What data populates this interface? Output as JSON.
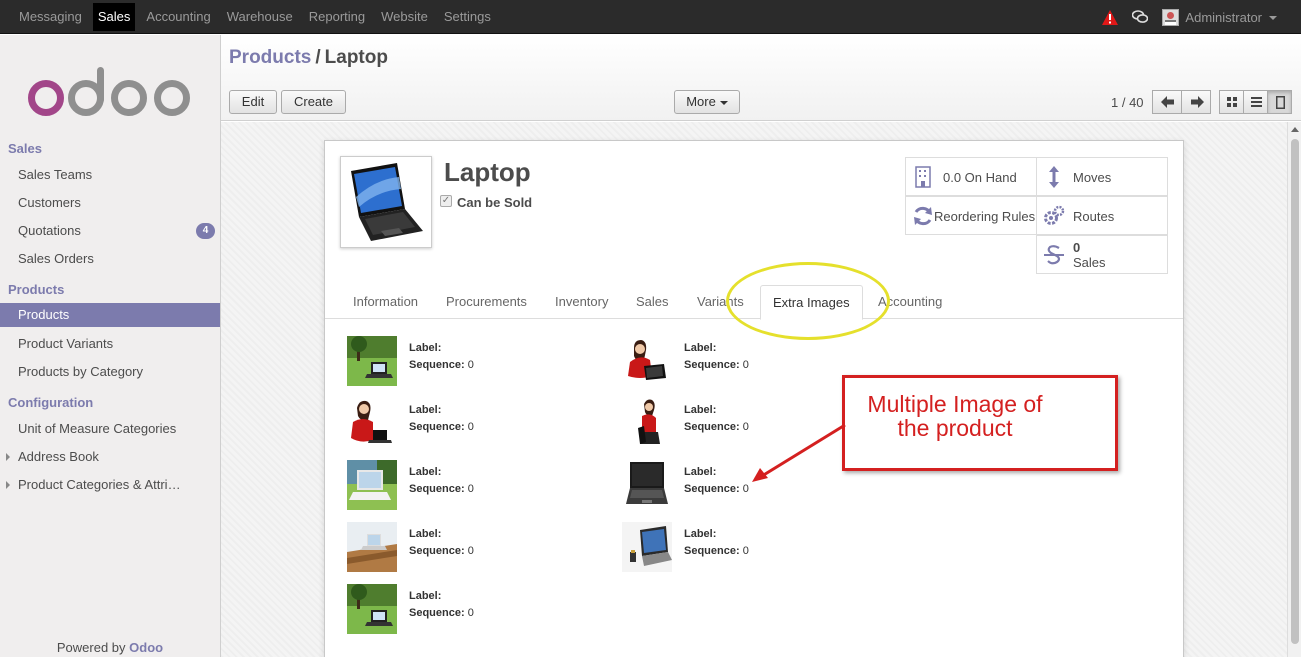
{
  "topbar": {
    "menu": [
      "Messaging",
      "Sales",
      "Accounting",
      "Warehouse",
      "Reporting",
      "Website",
      "Settings"
    ],
    "active": "Sales",
    "user": "Administrator"
  },
  "sidebar": {
    "sections": {
      "sales": "Sales",
      "products": "Products",
      "configuration": "Configuration"
    },
    "items": {
      "sales_teams": "Sales Teams",
      "customers": "Customers",
      "quotations": "Quotations",
      "quotations_badge": "4",
      "sales_orders": "Sales Orders",
      "products": "Products",
      "product_variants": "Product Variants",
      "products_by_category": "Products by Category",
      "uom_categories": "Unit of Measure Categories",
      "address_book": "Address Book",
      "product_categories": "Product Categories & Attri…"
    },
    "powered_prefix": "Powered by ",
    "powered_brand": "Odoo"
  },
  "control_panel": {
    "breadcrumb_parent": "Products",
    "breadcrumb_sep": "/",
    "breadcrumb_current": "Laptop",
    "edit_label": "Edit",
    "create_label": "Create",
    "more_label": "More",
    "pager": "1 / 40"
  },
  "product": {
    "name": "Laptop",
    "can_be_sold_label": "Can be Sold",
    "can_be_sold": true
  },
  "smart_buttons": {
    "on_hand": "0.0 On Hand",
    "moves": "Moves",
    "reordering": "Reordering Rules",
    "routes": "Routes",
    "sales_count": "0",
    "sales_label": "Sales"
  },
  "tabs": [
    "Information",
    "Procurements",
    "Inventory",
    "Sales",
    "Variants",
    "Extra Images",
    "Accounting"
  ],
  "active_tab": "Extra Images",
  "extra_images": {
    "label_caption": "Label:",
    "sequence_caption": "Sequence:",
    "items": [
      {
        "label": "",
        "sequence": "0",
        "picture": "laptop on grass"
      },
      {
        "label": "",
        "sequence": "0",
        "picture": "woman with laptop"
      },
      {
        "label": "",
        "sequence": "0",
        "picture": "woman with laptop"
      },
      {
        "label": "",
        "sequence": "0",
        "picture": "woman with laptop"
      },
      {
        "label": "",
        "sequence": "0",
        "picture": "laptop on grass"
      },
      {
        "label": "",
        "sequence": "0",
        "picture": "black laptop"
      },
      {
        "label": "",
        "sequence": "0",
        "picture": "laptop on desk"
      },
      {
        "label": "",
        "sequence": "0",
        "picture": "laptop on table"
      },
      {
        "label": "",
        "sequence": "0",
        "picture": "laptop on grass"
      }
    ]
  },
  "annotation": {
    "callout_line1": "Multiple Image of",
    "callout_line2": "the product",
    "ellipse_color": "#e5e02c",
    "callout_color": "#d42020"
  },
  "colors": {
    "brand": "#7c7bad",
    "topbar": "#2b2b2b"
  }
}
